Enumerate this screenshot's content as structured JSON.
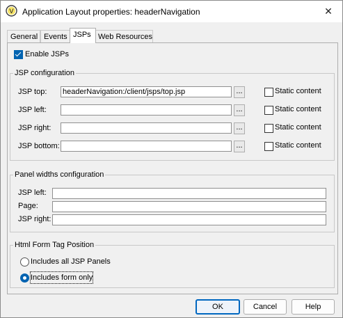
{
  "window": {
    "title": "Application Layout properties: headerNavigation",
    "app_icon_letter": "V",
    "close_glyph": "✕"
  },
  "tabs": [
    {
      "label": "General",
      "active": false
    },
    {
      "label": "Events",
      "active": false
    },
    {
      "label": "JSPs",
      "active": true
    },
    {
      "label": "Web Resources",
      "active": false
    }
  ],
  "enable_jsps": {
    "label": "Enable JSPs",
    "checked": true
  },
  "jsp_config": {
    "legend": "JSP configuration",
    "browse_label": "...",
    "static_label": "Static content",
    "rows": [
      {
        "label": "JSP top:",
        "value": "headerNavigation:/client/jsps/top.jsp",
        "static": false
      },
      {
        "label": "JSP left:",
        "value": "",
        "static": false
      },
      {
        "label": "JSP right:",
        "value": "",
        "static": false
      },
      {
        "label": "JSP bottom:",
        "value": "",
        "static": false
      }
    ]
  },
  "panel_widths": {
    "legend": "Panel widths configuration",
    "rows": [
      {
        "label": "JSP left:",
        "value": ""
      },
      {
        "label": "Page:",
        "value": ""
      },
      {
        "label": "JSP right:",
        "value": ""
      }
    ]
  },
  "form_tag": {
    "legend": "Html Form Tag Position",
    "options": [
      {
        "label": "Includes all JSP Panels",
        "selected": false
      },
      {
        "label": "Includes form only",
        "selected": true
      }
    ]
  },
  "buttons": {
    "ok": "OK",
    "cancel": "Cancel",
    "help": "Help"
  },
  "colors": {
    "accent": "#0063b1",
    "dialog_bg": "#f0f0f0"
  }
}
